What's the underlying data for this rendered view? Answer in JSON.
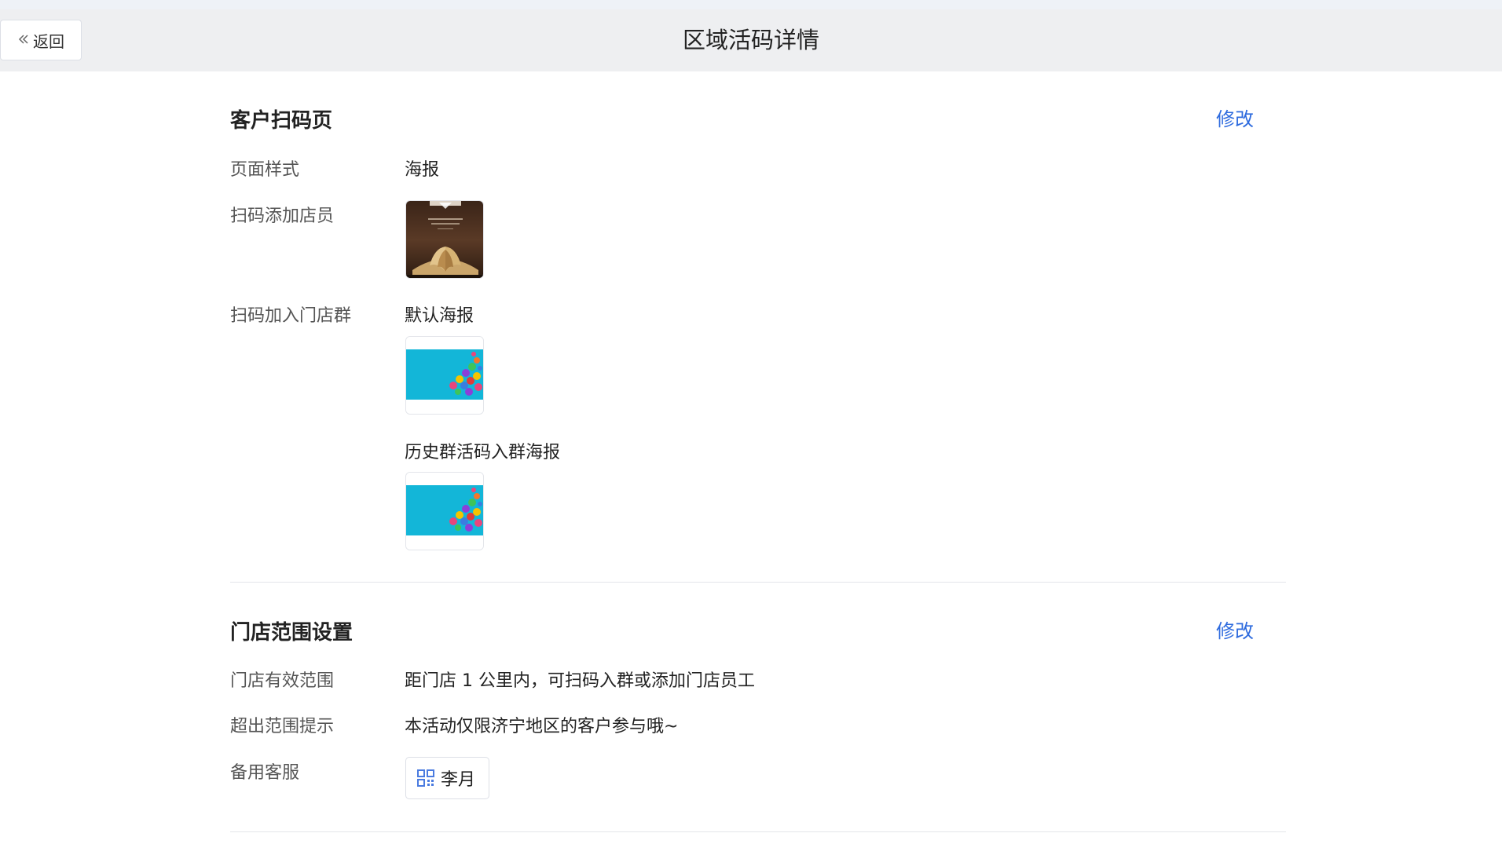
{
  "header": {
    "back_label": "返回",
    "title": "区域活码详情"
  },
  "scan_page": {
    "title": "客户扫码页",
    "edit_label": "修改",
    "page_style_label": "页面样式",
    "page_style_value": "海报",
    "add_staff_label": "扫码添加店员",
    "join_group_label": "扫码加入门店群",
    "default_poster_label": "默认海报",
    "history_poster_label": "历史群活码入群海报"
  },
  "store_range": {
    "title": "门店范围设置",
    "edit_label": "修改",
    "valid_range_label": "门店有效范围",
    "valid_range_value": "距门店 1 公里内，可扫码入群或添加门店员工",
    "out_of_range_label": "超出范围提示",
    "out_of_range_value": "本活动仅限济宁地区的客户参与哦~",
    "backup_service_label": "备用客服",
    "backup_service_name": "李月"
  },
  "colors": {
    "accent": "#2e6bde",
    "header_bg": "#eeeff1",
    "divider": "#e4e6ea",
    "poster_cyan": "#13b6d8"
  },
  "icons": {
    "back": "double-chevron-left-icon",
    "qrcode": "qrcode-icon"
  }
}
